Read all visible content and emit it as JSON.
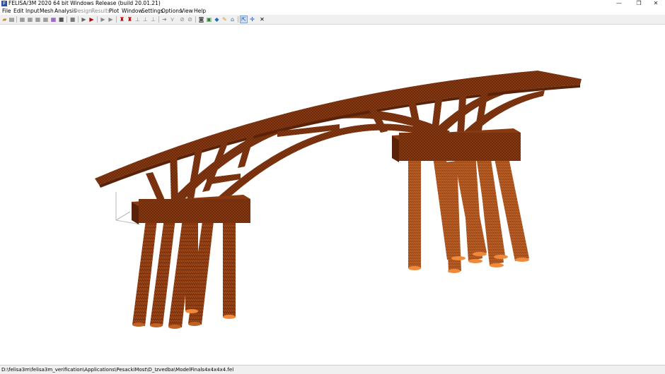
{
  "window": {
    "title": "FELISA/3M 2020 64 bit Windows Release (build 20.01.21)",
    "app_icon_glyph": "F",
    "controls": {
      "minimize": "—",
      "restore": "❐",
      "close": "✕"
    }
  },
  "menu": [
    "File",
    "Edit",
    "Input",
    "Mesh",
    "Analysis",
    "Design",
    "Results",
    "Plot",
    "Window",
    "Settings",
    "Options",
    "View",
    "Help"
  ],
  "menu_disabled": [
    "Design",
    "Results"
  ],
  "toolbar_icons": [
    "open-icon",
    "print-icon",
    "mesh-grid-icon",
    "mesh-edit-icon",
    "mesh-split-icon",
    "mesh-merge-icon",
    "mesh-color-icon",
    "mesh-fill-icon",
    "gray-box-icon",
    "run-icon",
    "run-red-icon",
    "step-icon",
    "step-next-icon",
    "support-icon",
    "support-red-icon",
    "load-icon",
    "load-alt-icon",
    "load-bar-icon",
    "arrow-icon",
    "spring-icon",
    "section-icon",
    "section-alt-icon",
    "camera-icon",
    "save-icon",
    "cube-icon",
    "brush-icon",
    "house-icon",
    "select-icon",
    "axis-icon",
    "close-x-icon"
  ],
  "status": {
    "path": "D:\\felisa3m\\felisa3m_verification\\Applications\\PesackiMost\\D_Izvedba\\ModelFinals4x4x4x4.fel"
  },
  "colors": {
    "model_dark": "#5a2208",
    "model_mid": "#8a3a10",
    "model_light": "#b5551a",
    "pile_end": "#f08a3a",
    "axis": "#a8a8a8"
  }
}
